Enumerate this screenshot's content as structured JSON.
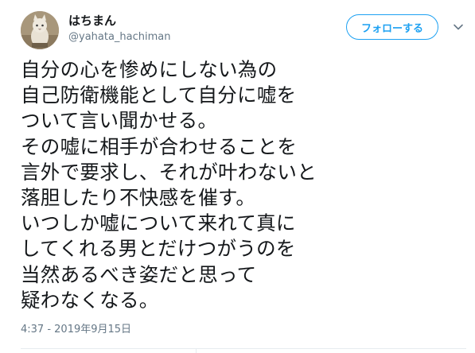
{
  "user": {
    "display_name": "はちまん",
    "handle": "@yahata_hachiman",
    "avatar_icon": "cat-avatar"
  },
  "actions": {
    "follow_label": "フォローする",
    "menu_icon": "chevron-down-icon"
  },
  "tweet": {
    "lines": [
      "自分の心を惨めにしない為の",
      "自己防衛機能として自分に嘘を",
      "ついて言い聞かせる。",
      "その嘘に相手が合わせることを",
      "言外で要求し、それが叶わないと",
      "落胆したり不快感を催す。",
      "いつしか嘘について来れて真に",
      "してくれる男とだけつがうのを",
      "当然あるべき姿だと思って",
      "疑わなくなる。"
    ],
    "timestamp": "4:37 - 2019年9月15日"
  },
  "colors": {
    "accent": "#1da1f2",
    "text": "#14171a",
    "muted": "#657786",
    "divider": "#e6ecf0"
  }
}
